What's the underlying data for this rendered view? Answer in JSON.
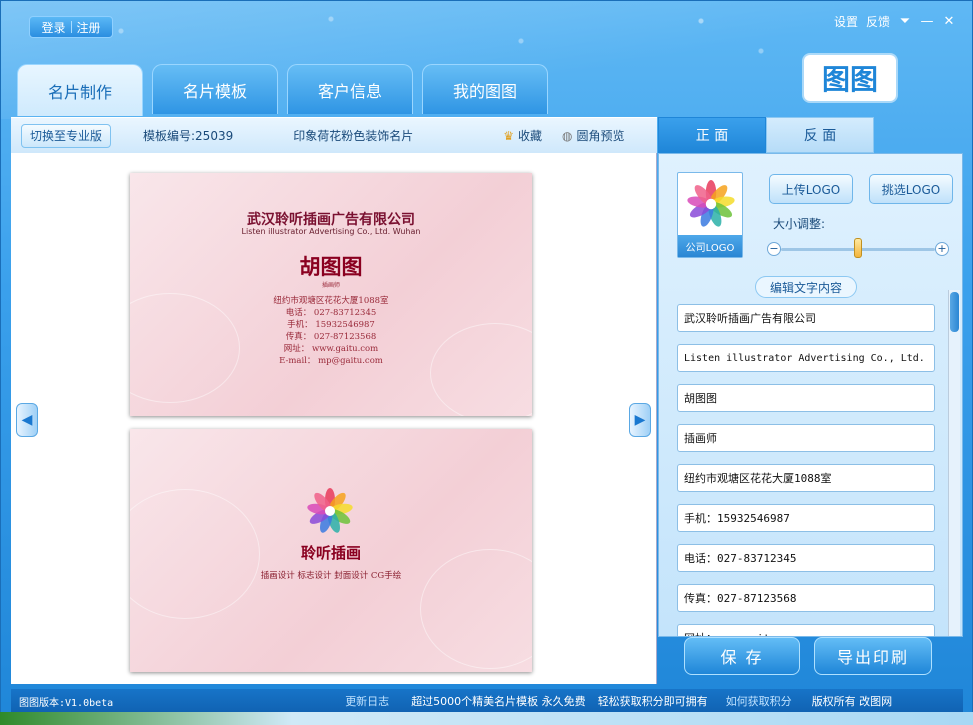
{
  "auth": {
    "login": "登录",
    "register": "注册"
  },
  "window": {
    "settings": "设置",
    "feedback": "反馈",
    "logo_text": "图图"
  },
  "tabs": [
    {
      "label": "名片制作",
      "active": true
    },
    {
      "label": "名片模板",
      "active": false
    },
    {
      "label": "客户信息",
      "active": false
    },
    {
      "label": "我的图图",
      "active": false
    }
  ],
  "toolbar": {
    "switch_pro": "切换至专业版",
    "template_code": "模板编号:25039",
    "template_name": "印象荷花粉色装饰名片",
    "favorite": "收藏",
    "round_preview": "圆角预览"
  },
  "card_front": {
    "company": "武汉聆听插画广告有限公司",
    "company_en": "Listen illustrator Advertising Co., Ltd. Wuhan",
    "name": "胡图图",
    "title": "插画师",
    "address": "纽约市观塘区花花大厦1088室",
    "phone": "电话： 027-83712345",
    "mobile": "手机： 15932546987",
    "fax": "传真： 027-87123568",
    "web": "网址： www.gaitu.com",
    "email": "E-mail： mp@gaitu.com"
  },
  "card_back": {
    "brand": "聆听插画",
    "tagline": "插画设计  标志设计  封面设计 CG手绘"
  },
  "side_tabs": {
    "front": "正  面",
    "back": "反  面"
  },
  "logo_panel": {
    "caption": "公司LOGO",
    "upload": "上传LOGO",
    "pick": "挑选LOGO",
    "size_label": "大小调整:",
    "size_level": 0.5
  },
  "edit_text_label": "编辑文字内容",
  "fields": [
    "武汉聆听插画广告有限公司",
    "Listen illustrator Advertising Co., Ltd.",
    "胡图图",
    "插画师",
    "纽约市观塘区花花大厦1088室",
    "手机：15932546987",
    "电话：027-83712345",
    "传真：027-87123568",
    "网址：www.gaitu.com"
  ],
  "actions": {
    "save": "保 存",
    "print": "导出印刷"
  },
  "status": {
    "version": "图图版本:V1.0beta",
    "changelog": "更新日志",
    "promo": "超过5000个精美名片模板 永久免费",
    "points": "轻松获取积分即可拥有",
    "how_points": "如何获取积分",
    "copyright": "版权所有 改图网"
  },
  "colors": {
    "accent": "#1f86d8",
    "card_text": "#8a0020"
  }
}
